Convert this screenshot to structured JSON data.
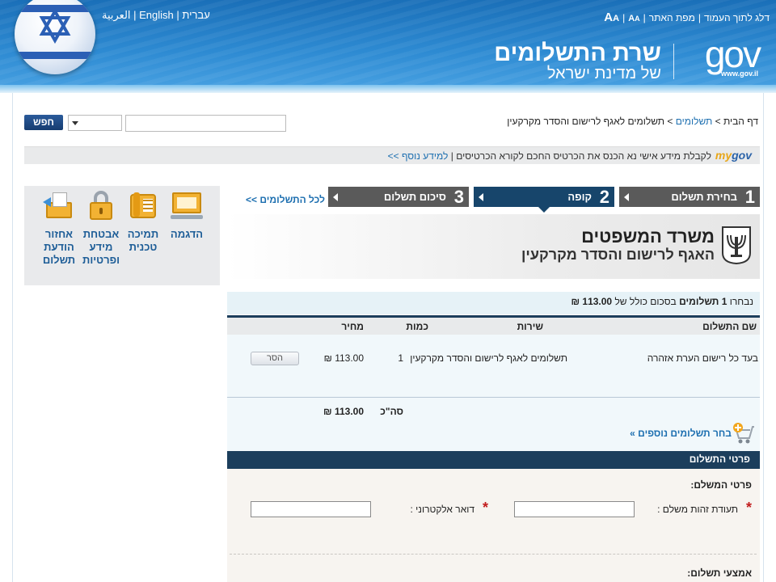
{
  "header": {
    "lang_links": [
      "עברית",
      "English",
      "العربية"
    ],
    "top_links": [
      "דלג לתוך העמוד",
      "מפת האתר"
    ],
    "font_large": "A",
    "font_small": "A",
    "site_title": "שרת התשלומים",
    "site_subtitle": "של מדינת ישראל",
    "gov_logo": "gov",
    "gov_url": "www.gov.il"
  },
  "breadcrumb": {
    "home": "דף הבית",
    "payments": "תשלומים",
    "current": "תשלומים לאגף לרישום והסדר מקרקעין"
  },
  "search": {
    "button_label": "חפש",
    "input_value": "",
    "select_value": ""
  },
  "mygov": {
    "logo_my": "my",
    "logo_gov": "gov",
    "text": "לקבלת מידע אישי נא הכנס את הכרטיס החכם לקורא הכרטיסים",
    "more_link": "למידע נוסף >>"
  },
  "side_panel": {
    "items": [
      {
        "label": "הדגמה",
        "icon": "demo-screen-icon"
      },
      {
        "label": "תמיכה טכנית",
        "icon": "phone-support-icon"
      },
      {
        "label": "אבטחת מידע ופרטיות",
        "icon": "padlock-icon"
      },
      {
        "label": "אחזור הודעת תשלום",
        "icon": "retrieve-receipt-icon"
      }
    ]
  },
  "steps": {
    "back_link": "לכל התשלומים >>",
    "items": [
      {
        "num": "1",
        "label": "בחירת תשלום"
      },
      {
        "num": "2",
        "label": "קופה"
      },
      {
        "num": "3",
        "label": "סיכום תשלום"
      }
    ]
  },
  "ministry": {
    "title": "משרד המשפטים",
    "subtitle": "האגף לרישום והסדר מקרקעין"
  },
  "summary": {
    "chosen_label": "נבחרו",
    "count_text": "1 תשלומים",
    "total_label": "בסכום כולל של",
    "total_value": "113.00 ₪"
  },
  "table": {
    "headers": {
      "name": "שם התשלום",
      "service": "שירות",
      "qty": "כמות",
      "price": "מחיר"
    },
    "rows": [
      {
        "name": "בעד כל רישום הערת אזהרה",
        "service": "תשלומים לאגף לרישום והסדר מקרקעין",
        "qty": "1",
        "price": "113.00 ₪",
        "remove_label": "הסר"
      }
    ],
    "total_label": "סה\"כ",
    "total_value": "113.00 ₪",
    "more_link": "בחר תשלומים נוספים »"
  },
  "payment": {
    "header": "פרטי התשלום",
    "payer_title": "פרטי המשלם:",
    "id_label": "תעודת זהות משלם :",
    "id_value": "",
    "email_label": "דואר אלקטרוני :",
    "email_value": "",
    "means_title": "אמצעי תשלום:"
  },
  "colors": {
    "header_blue": "#2d8ad2",
    "step_active": "#17456b",
    "step_inactive": "#5a5a5a",
    "link_blue": "#1d6fb0",
    "required_red": "#c21d1d"
  }
}
